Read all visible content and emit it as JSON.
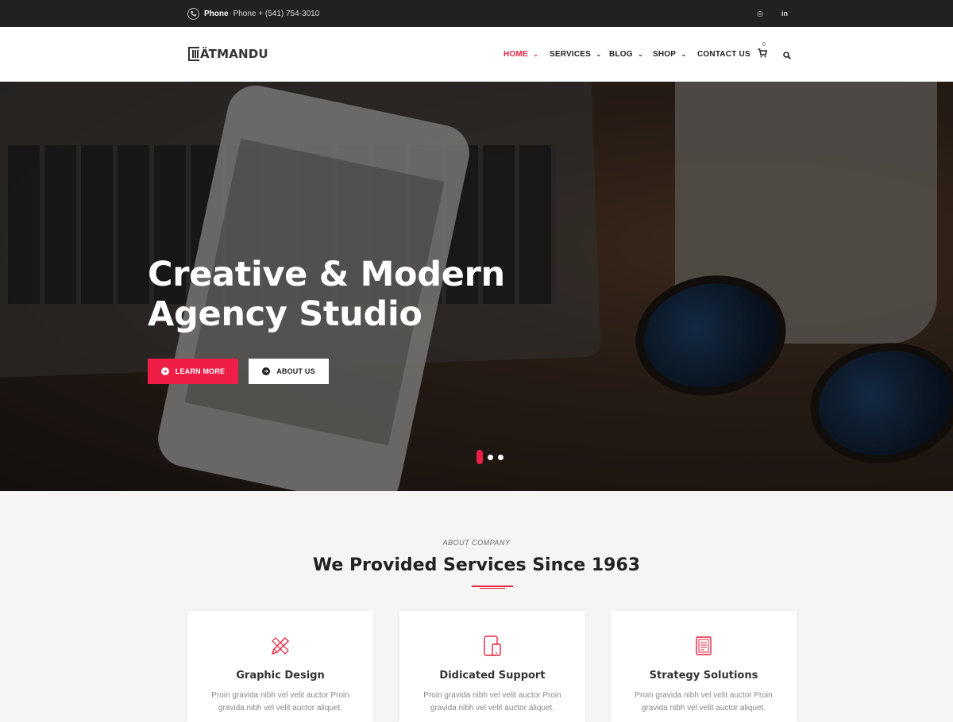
{
  "topbar": {
    "phone_label": "Phone",
    "phone_text": "Phone + (541) 754-3010",
    "social": [
      {
        "name": "instagram-icon",
        "glyph": "◎"
      },
      {
        "name": "linkedin-icon",
        "glyph": "in"
      }
    ]
  },
  "header": {
    "logo_text": "ÄTMANDU",
    "nav": [
      {
        "label": "HOME",
        "active": true,
        "has_dropdown": true
      },
      {
        "label": "SERVICES",
        "active": false,
        "has_dropdown": true
      },
      {
        "label": "BLOG",
        "active": false,
        "has_dropdown": true
      },
      {
        "label": "SHOP",
        "active": false,
        "has_dropdown": true
      },
      {
        "label": "CONTACT US",
        "active": false,
        "has_dropdown": false
      }
    ],
    "cart_count": "0"
  },
  "hero": {
    "title_line1": "Creative & Modern",
    "title_line2": "Agency Studio",
    "primary_button": "LEARN MORE",
    "secondary_button": "ABOUT US",
    "slide_count": 3,
    "active_slide": 1
  },
  "about": {
    "kicker": "ABOUT COMPANY",
    "title": "We Provided Services Since 1963",
    "cards": [
      {
        "icon": "pencil-ruler-icon",
        "title": "Graphic Design",
        "text": "Proin gravida nibh vel velit auctor Proin gravida nibh vel velit auctor aliquet."
      },
      {
        "icon": "devices-icon",
        "title": "Didicated Support",
        "text": "Proin gravida nibh vel velit auctor Proin gravida nibh vel velit auctor aliquet."
      },
      {
        "icon": "clipboard-icon",
        "title": "Strategy Solutions",
        "text": "Proin gravida nibh vel velit auctor Proin gravida nibh vel velit auctor aliquet."
      }
    ]
  },
  "colors": {
    "accent": "#ee1e46",
    "topbar_bg": "#212121",
    "section_bg": "#f5f5f5"
  }
}
